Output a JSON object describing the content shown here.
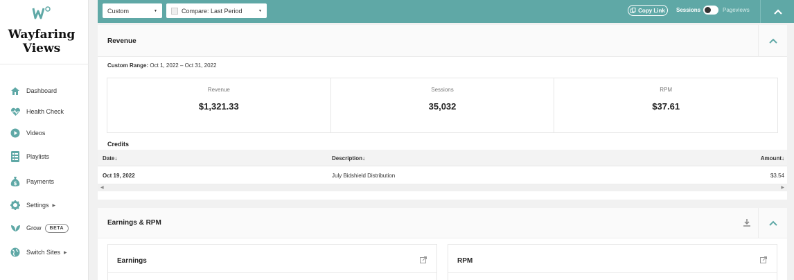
{
  "brand": {
    "name_line1": "Wayfaring",
    "name_line2": "Views",
    "logo_icon": "mv-logo-icon",
    "accent": "#5fa8a6"
  },
  "nav": [
    {
      "label": "Dashboard",
      "icon": "home-icon"
    },
    {
      "label": "Health Check",
      "icon": "heartbeat-icon"
    },
    {
      "label": "Videos",
      "icon": "play-icon"
    },
    {
      "label": "Playlists",
      "icon": "list-icon"
    },
    {
      "label": "Payments",
      "icon": "money-bag-icon"
    },
    {
      "label": "Settings",
      "icon": "gear-icon",
      "caret": "▶"
    },
    {
      "label": "Grow",
      "icon": "leaf-icon",
      "badge": "BETA"
    },
    {
      "label": "Switch Sites",
      "icon": "globe-icon",
      "caret": "▶"
    }
  ],
  "topbar": {
    "range_select": "Custom",
    "compare_select": "Compare: Last Period",
    "copy_link": "Copy Link",
    "toggle_left": "Sessions",
    "toggle_right": "Pageviews"
  },
  "revenue": {
    "title": "Revenue",
    "range_label": "Custom Range:",
    "range_value": "Oct 1, 2022 – Oct 31, 2022",
    "stats": [
      {
        "label": "Revenue",
        "value": "$1,321.33"
      },
      {
        "label": "Sessions",
        "value": "35,032"
      },
      {
        "label": "RPM",
        "value": "$37.61"
      }
    ],
    "credits_title": "Credits",
    "columns": {
      "date": "Date",
      "description": "Description",
      "amount": "Amount"
    },
    "rows": [
      {
        "date": "Oct 19, 2022",
        "description": "July Bidshield Distribution",
        "amount": "$3.54"
      }
    ]
  },
  "earnings": {
    "title": "Earnings & RPM",
    "cards": [
      {
        "title": "Earnings"
      },
      {
        "title": "RPM"
      }
    ]
  }
}
